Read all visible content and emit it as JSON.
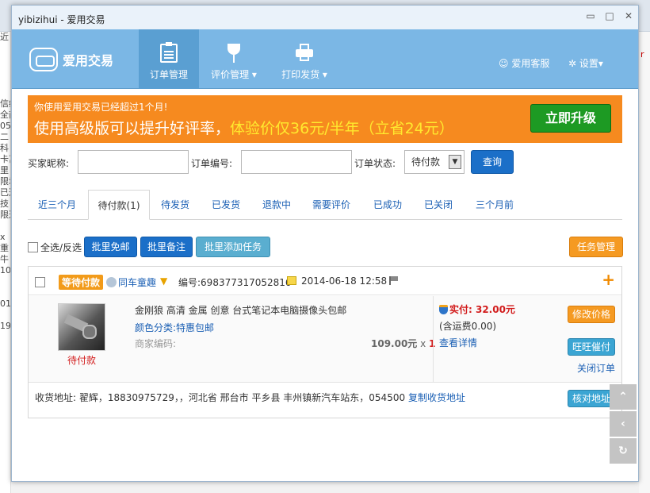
{
  "window": {
    "title_user": "yibizihui",
    "title_app": " - 爱用交易",
    "minimize": "▭",
    "maximize": "□",
    "close": "✕"
  },
  "header": {
    "logo_text": "爱用交易",
    "nav": [
      {
        "label": "订单管理",
        "active": true
      },
      {
        "label": "评价管理 ▾",
        "active": false
      },
      {
        "label": "打印发货 ▾",
        "active": false
      }
    ],
    "service": "爱用客服",
    "settings": "设置▾"
  },
  "banner": {
    "line1": "你使用爱用交易已经超过1个月!",
    "line2_a": "使用高级版可以提升好评率，",
    "line2_b": "体验价仅36元/半年（立省24元）",
    "upgrade": "立即升级"
  },
  "filter": {
    "buyer_label": "买家昵称:",
    "order_label": "订单编号:",
    "status_label": "订单状态:",
    "status_value": "待付款",
    "query": "查询"
  },
  "tabs": [
    "近三个月",
    "待付款(1)",
    "待发货",
    "已发货",
    "退款中",
    "需要评价",
    "已成功",
    "已关闭",
    "三个月前"
  ],
  "toolbar": {
    "select_all": "全选/反选",
    "batch_free": "批里免邮",
    "batch_note": "批里备注",
    "batch_task": "批里添加任务",
    "task_mgmt": "任务管理"
  },
  "order": {
    "status_badge": "等待付款",
    "buyer": "同车童趣",
    "order_no": "编号:698377317052816",
    "date": "2014-06-18 12:58",
    "plus": "+",
    "product_title": "金刚狼 高清 金属 创意 台式笔记本电脑摄像头包邮",
    "sku": "颜色分类:特惠包邮",
    "merchant_code": "商家编码:",
    "price": "109.00元",
    "qty_x": " x ",
    "qty": "1",
    "item_status": "待付款",
    "paid": "实付: 32.00元",
    "shipping": "(含运费0.00)",
    "view_detail": "查看详情",
    "edit_price": "修改价格",
    "wangwang": "旺旺催付",
    "close_order": "关闭订单",
    "address": "收货地址: 翟辉，18830975729，，河北省 邢台市 平乡县 丰州镇新汽车站东，054500",
    "copy_address": "复制收货地址",
    "verify_address": "核对地址"
  },
  "side_buttons": [
    "⌃",
    "‹",
    "↻"
  ],
  "background": {
    "left_fragments": [
      "近",
      "",
      "",
      "",
      "",
      "",
      "信经",
      "全商",
      "05",
      "二",
      "科",
      "卡莒",
      "里",
      "限均",
      "已达",
      "技",
      "限达",
      "",
      "x",
      "重",
      "牛",
      "10",
      "",
      "",
      "01",
      "",
      "19)"
    ]
  }
}
